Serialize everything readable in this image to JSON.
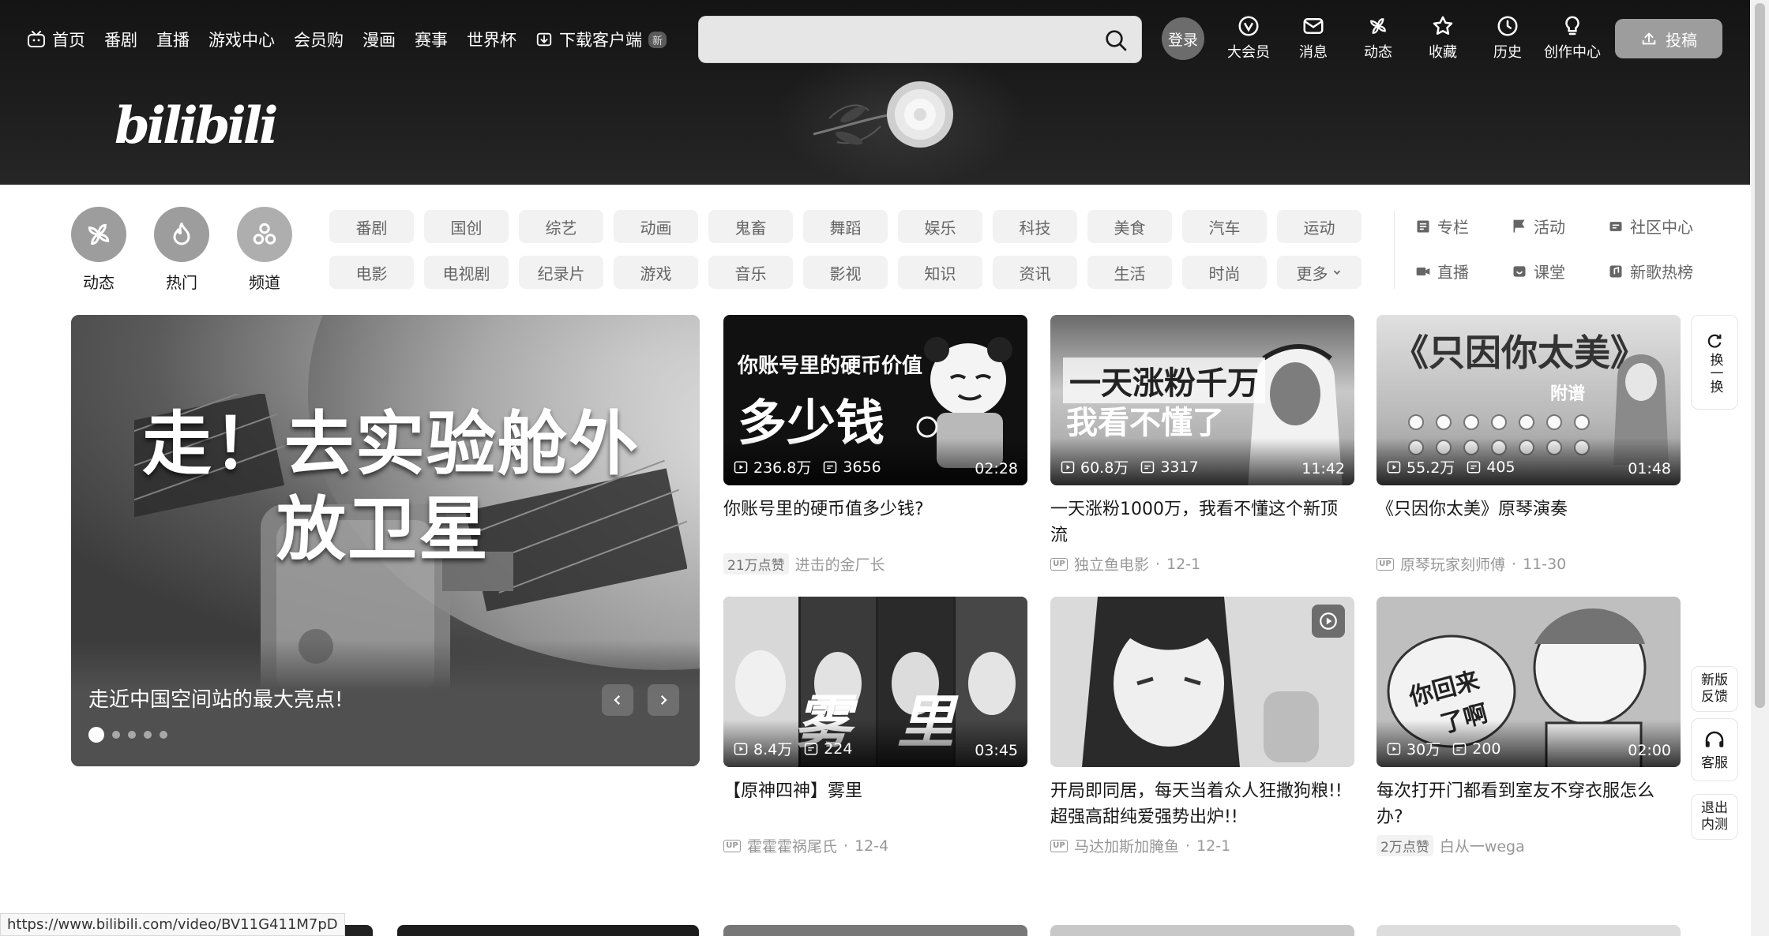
{
  "topnav": {
    "items": [
      "首页",
      "番剧",
      "直播",
      "游戏中心",
      "会员购",
      "漫画",
      "赛事",
      "世界杯",
      "下载客户端"
    ],
    "new_badge": "新"
  },
  "search": {
    "placeholder": ""
  },
  "login_label": "登录",
  "rightnav": [
    "大会员",
    "消息",
    "动态",
    "收藏",
    "历史",
    "创作中心"
  ],
  "upload_label": "投稿",
  "logo_text": "bilibili",
  "channels_big": [
    {
      "label": "动态",
      "color": "#a79a9e"
    },
    {
      "label": "热门",
      "color": "#a79a9e"
    },
    {
      "label": "频道",
      "color": "#a7b0ae"
    }
  ],
  "tags_row1": [
    "番剧",
    "国创",
    "综艺",
    "动画",
    "鬼畜",
    "舞蹈",
    "娱乐",
    "科技",
    "美食",
    "汽车",
    "运动"
  ],
  "tags_row2": [
    "电影",
    "电视剧",
    "纪录片",
    "游戏",
    "音乐",
    "影视",
    "知识",
    "资讯",
    "生活",
    "时尚",
    "更多"
  ],
  "links": [
    "专栏",
    "活动",
    "社区中心",
    "直播",
    "课堂",
    "新歌热榜"
  ],
  "carousel": {
    "headline_1": "走！去实验舱外",
    "headline_2": "放卫星",
    "caption": "走近中国空间站的最大亮点!",
    "dots": 5
  },
  "cards": [
    {
      "views": "236.8万",
      "danmaku": "3656",
      "duration": "02:28",
      "title": "你账号里的硬币值多少钱?",
      "likes": "21万点赞",
      "author": "进击的金厂长",
      "date": "",
      "thumb_text_1": "你账号里的硬币价值",
      "thumb_text_2": "多少钱"
    },
    {
      "views": "60.8万",
      "danmaku": "3317",
      "duration": "11:42",
      "title": "一天涨粉1000万，我看不懂这个新顶流",
      "likes": "",
      "author": "独立鱼电影",
      "date": "12-1",
      "thumb_text_1": "一天涨粉千万",
      "thumb_text_2": "我看不懂了"
    },
    {
      "views": "55.2万",
      "danmaku": "405",
      "duration": "01:48",
      "title": "《只因你太美》原琴演奏",
      "likes": "",
      "author": "原琴玩家刻师傅",
      "date": "11-30",
      "thumb_text_1": "《只因你太美》",
      "thumb_text_2": "附谱"
    },
    {
      "views": "8.4万",
      "danmaku": "224",
      "duration": "03:45",
      "title": "【原神四神】雾里",
      "likes": "",
      "author": "霍霍霍祸尾氏",
      "date": "12-4",
      "thumb_text_1": "雾",
      "thumb_text_2": "里"
    },
    {
      "views": "",
      "danmaku": "",
      "duration": "",
      "title": "开局即同居，每天当着众人狂撒狗粮!!超强高甜纯爱强势出炉!!",
      "likes": "",
      "author": "马达加斯加腌鱼",
      "date": "12-1",
      "thumb_text_1": "",
      "thumb_text_2": ""
    },
    {
      "views": "30万",
      "danmaku": "200",
      "duration": "02:00",
      "title": "每次打开门都看到室友不穿衣服怎么办?",
      "likes": "2万点赞",
      "author": "白从一wega",
      "date": "",
      "thumb_text_1": "你回来",
      "thumb_text_2": "了啊"
    }
  ],
  "side_buttons": {
    "refresh": "换一换",
    "feedback": "新版反馈",
    "service": "客服",
    "exit": "退出内测"
  },
  "status_url": "https://www.bilibili.com/video/BV11G411M7pD",
  "up_badge": "UP"
}
